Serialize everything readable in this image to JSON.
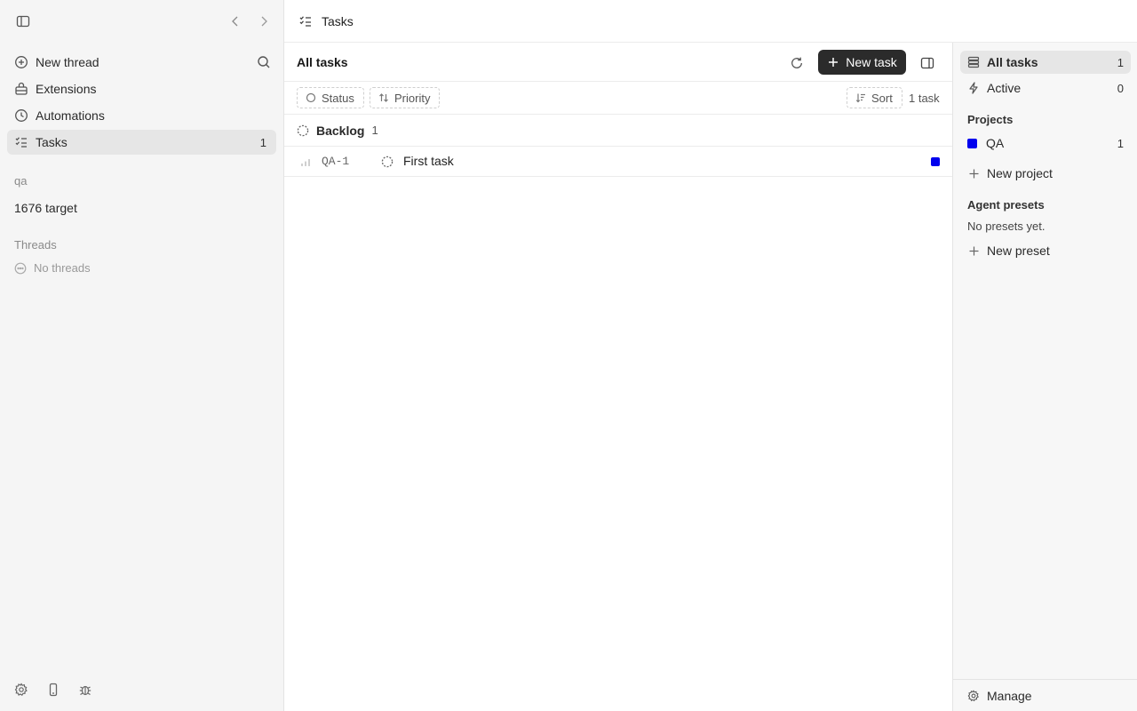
{
  "header": {
    "title": "Tasks",
    "icon": "tasks-list-icon"
  },
  "sidebar": {
    "nav": [
      {
        "label": "New thread",
        "icon": "plus-circle-icon"
      },
      {
        "label": "Extensions",
        "icon": "extensions-icon"
      },
      {
        "label": "Automations",
        "icon": "clock-icon"
      },
      {
        "label": "Tasks",
        "icon": "tasks-list-icon",
        "count": "1",
        "active": true
      }
    ],
    "workspace_label": "qa",
    "workspace_item": "1676 target",
    "threads_label": "Threads",
    "no_threads": "No threads"
  },
  "toolbar": {
    "title": "All tasks",
    "new_task_label": "New task"
  },
  "filters": {
    "status_label": "Status",
    "priority_label": "Priority",
    "sort_label": "Sort",
    "task_count": "1 task"
  },
  "groups": [
    {
      "name": "Backlog",
      "count": "1",
      "tasks": [
        {
          "id": "QA-1",
          "name": "First task",
          "project_color": "#0000ee"
        }
      ]
    }
  ],
  "right_panel": {
    "all_tasks_label": "All tasks",
    "all_tasks_count": "1",
    "active_label": "Active",
    "active_count": "0",
    "projects_label": "Projects",
    "projects": [
      {
        "name": "QA",
        "count": "1",
        "color": "#0000ee"
      }
    ],
    "new_project_label": "New project",
    "presets_label": "Agent presets",
    "no_presets": "No presets yet.",
    "new_preset_label": "New preset",
    "manage_label": "Manage"
  },
  "colors": {
    "accent_dark": "#2b2b2b",
    "project_blue": "#0000ee"
  }
}
